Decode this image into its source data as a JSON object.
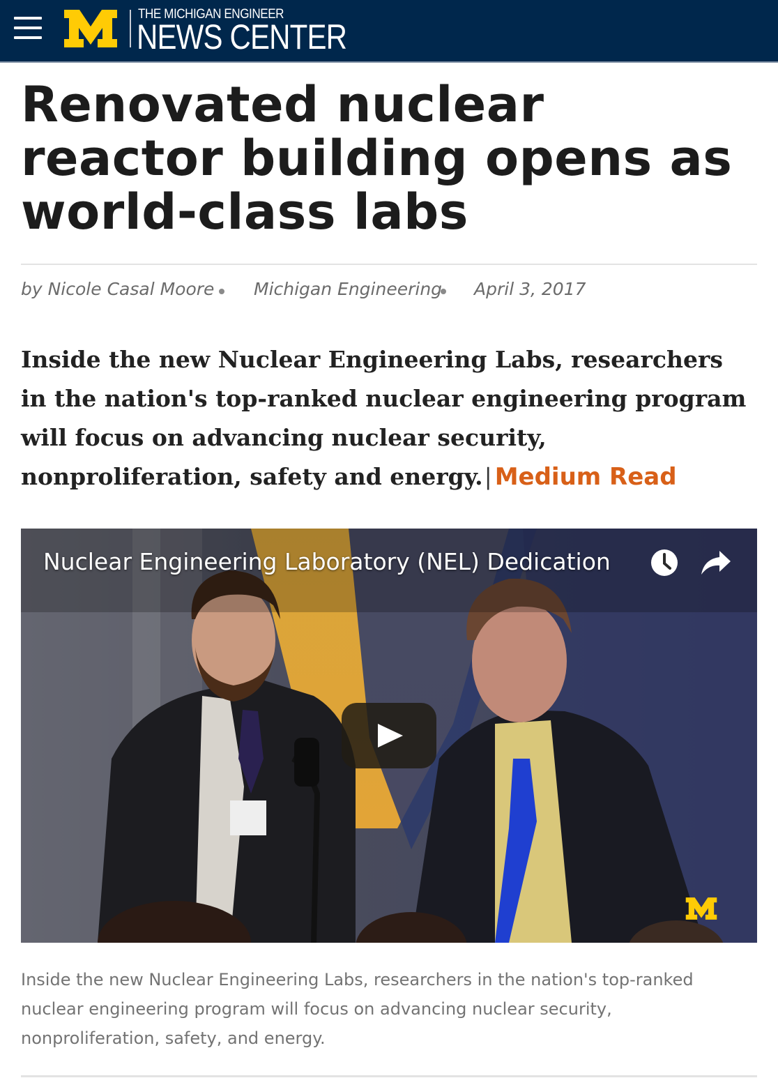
{
  "header": {
    "menu_icon": "hamburger-menu-icon",
    "logo_letter": "M",
    "brand_top": "THE MICHIGAN ENGINEER",
    "brand_main": "NEWS CENTER",
    "colors": {
      "bar": "#00274c",
      "maize": "#ffcb05"
    }
  },
  "article": {
    "title": "Renovated nuclear reactor building opens as world-class labs",
    "byline": {
      "author": "by Nicole Casal Moore",
      "source": "Michigan Engineering",
      "date": "April 3, 2017"
    },
    "dek": "Inside the new Nuclear Engineering Labs, researchers in the nation's top-ranked nuclear engineering program will focus on advancing nuclear security, nonproliferation, safety and energy.",
    "dek_separator": "|",
    "read_time": "Medium Read",
    "accent_color": "#d86018"
  },
  "video": {
    "title": "Nuclear Engineering Laboratory (NEL) Dedication",
    "watch_later_icon": "clock-icon",
    "share_icon": "share-arrow-icon",
    "play_icon": "play-icon",
    "watermark": "M"
  },
  "caption": "Inside the new Nuclear Engineering Labs, researchers in the nation's top-ranked nuclear engineering program will focus on advancing nuclear security, nonproliferation, safety, and energy."
}
